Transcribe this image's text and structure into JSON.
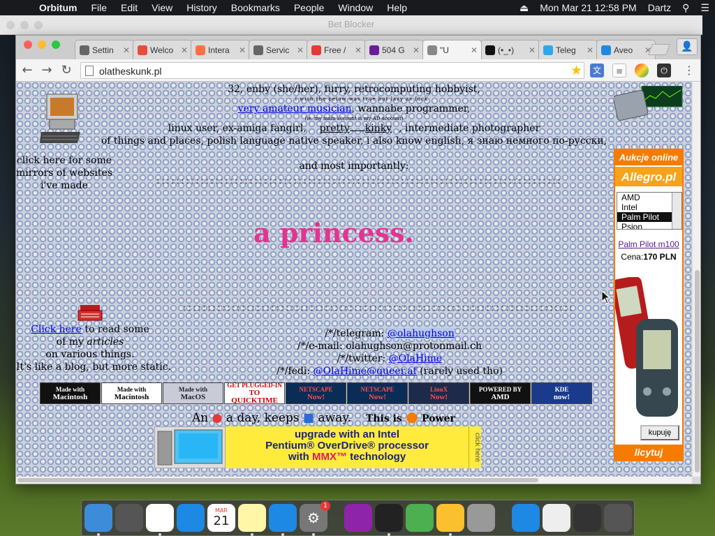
{
  "menubar": {
    "app": "Orbitum",
    "items": [
      "File",
      "Edit",
      "View",
      "History",
      "Bookmarks",
      "People",
      "Window",
      "Help"
    ],
    "clock": "Mon Mar 21  12:58 PM",
    "user": "Dartz"
  },
  "background_window": {
    "title": "Bet Blocker"
  },
  "tabs": [
    {
      "title": "Settin",
      "icon": "gear-icon",
      "color": "#666"
    },
    {
      "title": "Welco",
      "icon": "orbitum-icon",
      "color": "#e74c3c"
    },
    {
      "title": "Intera",
      "icon": "wave-icon",
      "color": "#ff7043"
    },
    {
      "title": "Servic",
      "icon": "gear-icon",
      "color": "#666"
    },
    {
      "title": "Free /",
      "icon": "globe-icon",
      "color": "#e53935"
    },
    {
      "title": "504 G",
      "icon": "w-icon",
      "color": "#6a1b9a"
    },
    {
      "title": "\"U",
      "icon": "page-icon",
      "color": "#888",
      "active": true
    },
    {
      "title": "(•_•)",
      "icon": "face-icon",
      "color": "#111"
    },
    {
      "title": "Teleg",
      "icon": "telegram-icon",
      "color": "#29a9eb"
    },
    {
      "title": "Aveo",
      "icon": "spinner-icon",
      "color": "#1e88e5"
    }
  ],
  "url": "olatheskunk.pl",
  "page": {
    "line1": "32, enby (she/her), furry, retrocomputing hobbyist,",
    "tiny_note": "i wish the below was true but lazy as fuck",
    "musician_link": "very amateur musician",
    "line2_rest": ", wannabe programmer,",
    "ad_note": "(ie. my main account is my AD account)",
    "line3a": "linux user, ex-amiga fangirl,",
    "pretty": "pretty",
    "kinky": "kinky",
    "line3b": ", intermediate photographer",
    "line4": "of things and places, polish language native speaker, i also know english, я знаю немного по-русски,",
    "most": "and most importantly:",
    "princess": "a princess.",
    "mirrors": [
      "click here for some",
      "mirrors of websites",
      "i've made"
    ],
    "click_here": "Click here",
    "articles_text": " to read some",
    "of_my": "of my ",
    "articles": "articles",
    "various": "on various things.",
    "blog": "It's like a blog, but more static.",
    "telegram_prefix": "/*/telegram: ",
    "telegram": "@olahughson",
    "email": "/*/e-mail: olahughson@protonmail.ch",
    "twitter_prefix": "/*/twitter: ",
    "twitter": "@OlaHime",
    "fedi_prefix": "/*/fedi: ",
    "fedi": "@OlaHime@queer.af",
    "fedi_suffix": " (rarely used tho)",
    "apple_day_a": "An",
    "apple_day_b": "a day, keeps",
    "apple_day_c": "away.",
    "this_is": "This is",
    "power": "Power"
  },
  "badges": [
    {
      "line1": "Made with",
      "line2": "Macintosh",
      "bg": "#111",
      "fg": "#fff"
    },
    {
      "line1": "Made with",
      "line2": "Macintosh",
      "bg": "#fff",
      "fg": "#000"
    },
    {
      "line1": "Made with",
      "line2": "MacOS",
      "bg": "#c9ccd6",
      "fg": "#223"
    },
    {
      "line1": "GET PLUGGED-IN",
      "line2": "TO QUICKTIME",
      "bg": "#fff",
      "fg": "#c00"
    },
    {
      "line1": "NETSCAPE",
      "line2": "Now!",
      "bg": "#0a2c56",
      "fg": "#ff4d4d"
    },
    {
      "line1": "NETSCAPE",
      "line2": "Now!",
      "bg": "#0a2c56",
      "fg": "#ff4d4d"
    },
    {
      "line1": "LinuX",
      "line2": "Now!",
      "bg": "#1d2a49",
      "fg": "#ff4d4d"
    },
    {
      "line1": "POWERED BY",
      "line2": "AMD",
      "bg": "#111",
      "fg": "#fff"
    },
    {
      "line1": "KDE",
      "line2": "now!",
      "bg": "#1a3b8c",
      "fg": "#fff"
    }
  ],
  "intel_ad": {
    "line1": "upgrade with an Intel",
    "line2": "Pentium® OverDrive® processor",
    "line3a": "with ",
    "mmx": "MMX™",
    "line3b": " technology",
    "side": "click here"
  },
  "allegro": {
    "header": "Aukcje online",
    "logo": "Allegro.pl",
    "options": [
      "AMD",
      "Intel",
      "Palm Pilot",
      "Psion"
    ],
    "selected": "Palm Pilot",
    "product": "Palm Pilot m100",
    "price_label": "Cena:",
    "price": "170 PLN",
    "buy": "kupuję",
    "footer": "licytuj"
  },
  "dock": [
    "Finder",
    "Launchpad",
    "Chrome",
    "Safari",
    "Calendar",
    "Notes",
    "App Store",
    "System Preferences",
    "Potion",
    "Opera",
    "BlueStacks",
    "Orbitum",
    "Keychain",
    "App Store Downloads",
    "Preview",
    "Terminal",
    "Trash"
  ],
  "calendar_day": "21",
  "calendar_month": "MAR",
  "notif_badge": "1"
}
